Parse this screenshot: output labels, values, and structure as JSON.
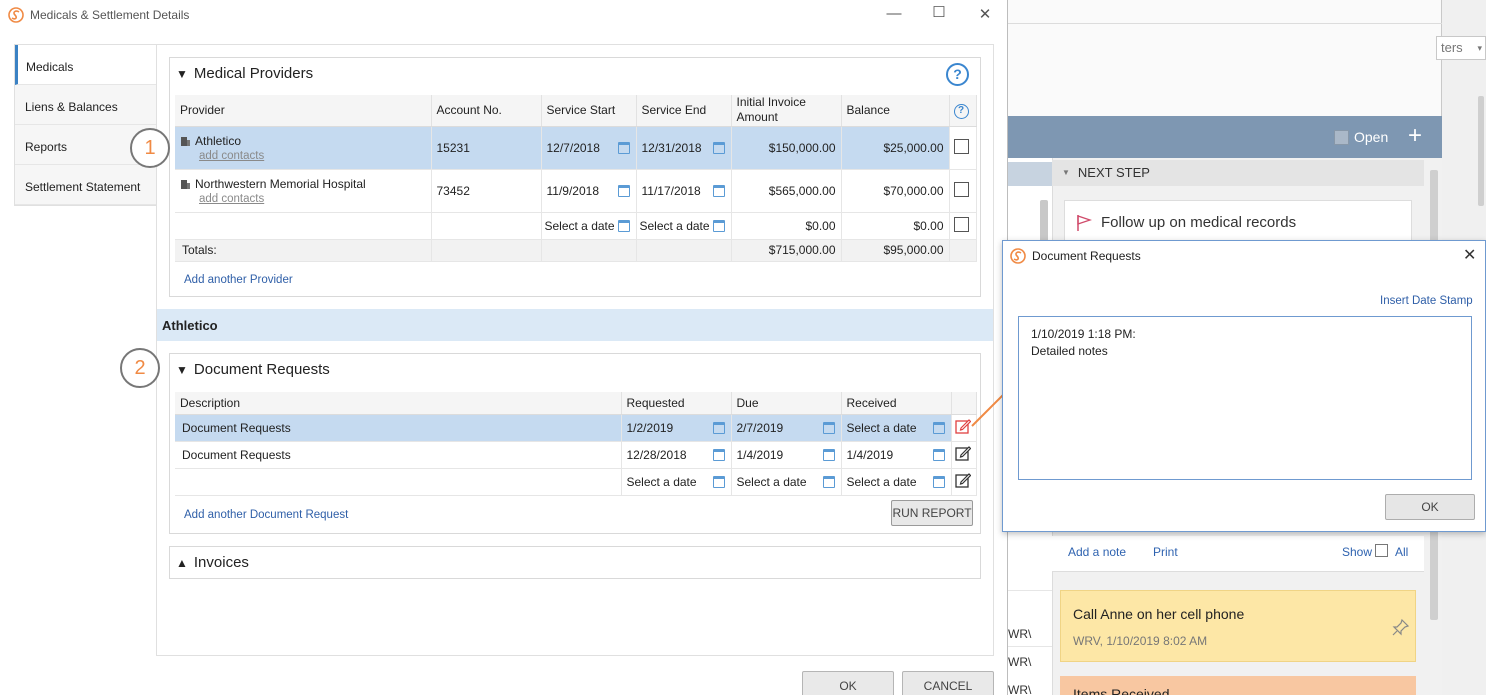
{
  "window": {
    "title": "Medicals & Settlement Details",
    "minimize": "—",
    "maximize": "☐",
    "close": "✕"
  },
  "tabs": [
    {
      "label": "Medicals",
      "active": true
    },
    {
      "label": "Liens & Balances"
    },
    {
      "label": "Reports"
    },
    {
      "label": "Settlement Statement"
    }
  ],
  "medical_providers": {
    "title": "Medical Providers",
    "toggle": "▼",
    "help": "?",
    "columns": {
      "provider": "Provider",
      "account": "Account No.",
      "start": "Service Start",
      "end": "Service End",
      "invoice": "Initial Invoice Amount",
      "balance": "Balance",
      "help": "?"
    },
    "rows": [
      {
        "provider": "Athletico",
        "sub": "add contacts",
        "account": "15231",
        "start": "12/7/2018",
        "end": "12/31/2018",
        "invoice": "$150,000.00",
        "balance": "$25,000.00"
      },
      {
        "provider": "Northwestern Memorial Hospital",
        "sub": "add contacts",
        "account": "73452",
        "start": "11/9/2018",
        "end": "11/17/2018",
        "invoice": "$565,000.00",
        "balance": "$70,000.00"
      },
      {
        "provider": "",
        "sub": "",
        "account": "",
        "start": "Select a date",
        "end": "Select a date",
        "invoice": "$0.00",
        "balance": "$0.00"
      }
    ],
    "totals": {
      "label": "Totals:",
      "invoice": "$715,000.00",
      "balance": "$95,000.00"
    },
    "add_link": "Add another Provider"
  },
  "selected_provider": "Athletico",
  "badges": {
    "one": "1",
    "two": "2"
  },
  "document_requests": {
    "title": "Document Requests",
    "toggle": "▼",
    "columns": {
      "description": "Description",
      "requested": "Requested",
      "due": "Due",
      "received": "Received"
    },
    "rows": [
      {
        "description": "Document Requests",
        "requested": "1/2/2019",
        "due": "2/7/2019",
        "received": "Select a date"
      },
      {
        "description": "Document Requests",
        "requested": "12/28/2018",
        "due": "1/4/2019",
        "received": "1/4/2019"
      },
      {
        "description": "",
        "requested": "Select a date",
        "due": "Select a date",
        "received": "Select a date"
      }
    ],
    "add_link": "Add another Document Request",
    "run_report": "RUN REPORT"
  },
  "invoices": {
    "title": "Invoices",
    "toggle": "▲"
  },
  "footer": {
    "ok": "OK",
    "cancel": "CANCEL"
  },
  "popup": {
    "title": "Document Requests",
    "close": "✕",
    "insert_stamp": "Insert Date Stamp",
    "text_line1": "1/10/2019 1:18 PM:",
    "text_line2": "Detailed notes",
    "ok": "OK"
  },
  "background": {
    "filter_partial": "ters",
    "filter_arrow": "▾",
    "open_label": "Open",
    "plus": "+",
    "next_step": "NEXT STEP",
    "next_step_toggle": "▼",
    "next_card": "Follow up on medical records",
    "add_note": "Add a note",
    "print": "Print",
    "show": "Show",
    "all": "All",
    "note1_title": "Call Anne on her cell phone",
    "note1_sub": "WRV, 1/10/2019 8:02 AM",
    "note2_title": "Items Received",
    "row_txt": "WR\\"
  },
  "colors": {
    "accent": "#3b82c4",
    "selected_row": "#c5daf0",
    "band": "#7e97b2",
    "note_yellow": "#fde7a6",
    "note_orange": "#f8c7a1",
    "badge_num": "#f08a44",
    "arrow": "#f08a44"
  }
}
